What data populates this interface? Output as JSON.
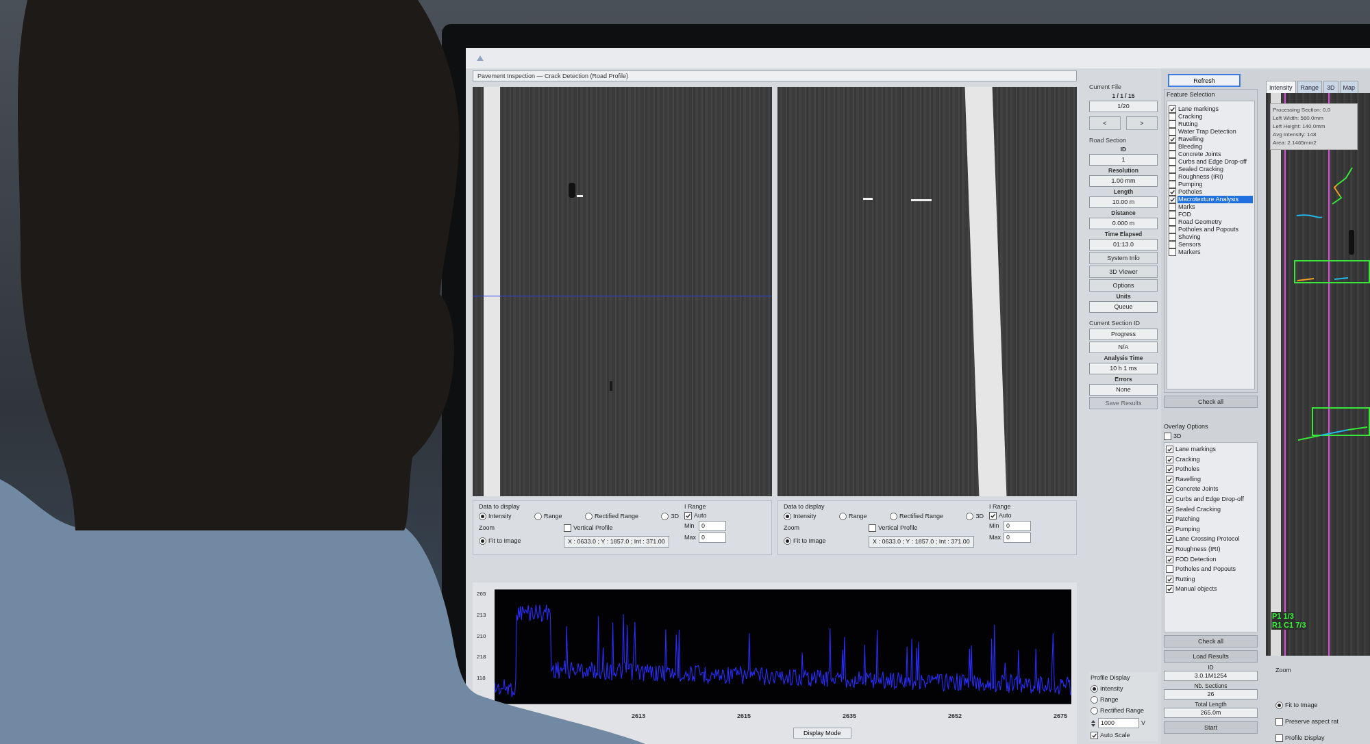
{
  "window": {
    "title": "Pavement Inspection — Crack Detection (Road Profile)"
  },
  "views": [
    {
      "data_label": "Data to display",
      "data_options": [
        {
          "label": "Intensity",
          "selected": true
        },
        {
          "label": "Range",
          "selected": false
        },
        {
          "label": "Rectified Range",
          "selected": false
        },
        {
          "label": "3D",
          "selected": false
        }
      ],
      "zoom_label": "Zoom",
      "zoom_option": {
        "label": "Fit to Image",
        "selected": true
      },
      "vertical_profile": {
        "label": "Vertical Profile",
        "checked": false
      },
      "readout": "X : 0633.0 ; Y : 1857.0 ; Int : 371.00",
      "range_label": "I Range",
      "auto": {
        "label": "Auto",
        "checked": true
      },
      "min": {
        "label": "Min",
        "value": "0"
      },
      "max": {
        "label": "Max",
        "value": "0"
      }
    },
    {
      "data_label": "Data to display",
      "data_options": [
        {
          "label": "Intensity",
          "selected": true
        },
        {
          "label": "Range",
          "selected": false
        },
        {
          "label": "Rectified Range",
          "selected": false
        },
        {
          "label": "3D",
          "selected": false
        }
      ],
      "zoom_label": "Zoom",
      "zoom_option": {
        "label": "Fit to Image",
        "selected": true
      },
      "vertical_profile": {
        "label": "Vertical Profile",
        "checked": false
      },
      "readout": "X : 0633.0 ; Y : 1857.0 ; Int : 371.00",
      "range_label": "I Range",
      "auto": {
        "label": "Auto",
        "checked": true
      },
      "min": {
        "label": "Min",
        "value": "0"
      },
      "max": {
        "label": "Max",
        "value": "0"
      }
    }
  ],
  "profile": {
    "y_labels": [
      "265",
      "213",
      "210",
      "218",
      "118"
    ],
    "x_labels": [
      "2613",
      "2615",
      "2635",
      "2652",
      "2675"
    ],
    "button": "Display Mode"
  },
  "nav": [
    {
      "kind": "label",
      "text": "Current File"
    },
    {
      "kind": "caption",
      "text": "1 / 1 / 15"
    },
    {
      "kind": "field",
      "text": "1/20"
    },
    {
      "kind": "pair",
      "items": [
        "<",
        ">"
      ]
    },
    {
      "kind": "label",
      "text": "Road Section"
    },
    {
      "kind": "caption",
      "text": "ID"
    },
    {
      "kind": "field",
      "text": "1"
    },
    {
      "kind": "caption",
      "text": "Resolution"
    },
    {
      "kind": "field",
      "text": "1.00 mm"
    },
    {
      "kind": "caption",
      "text": "Length"
    },
    {
      "kind": "field",
      "text": "10.00 m"
    },
    {
      "kind": "caption",
      "text": "Distance"
    },
    {
      "kind": "field",
      "text": "0.000 m"
    },
    {
      "kind": "caption",
      "text": "Time Elapsed"
    },
    {
      "kind": "field",
      "text": "01:13.0"
    },
    {
      "kind": "button",
      "text": "System Info",
      "disabled": false
    },
    {
      "kind": "button",
      "text": "3D Viewer",
      "disabled": false
    },
    {
      "kind": "button",
      "text": "Options",
      "disabled": false
    },
    {
      "kind": "caption",
      "text": "Units"
    },
    {
      "kind": "field",
      "text": "Queue"
    },
    {
      "kind": "label",
      "text": "Current Section ID"
    },
    {
      "kind": "field",
      "text": "Progress"
    },
    {
      "kind": "field",
      "text": "N/A"
    },
    {
      "kind": "caption",
      "text": "Analysis Time"
    },
    {
      "kind": "field",
      "text": "10 h 1 ms"
    },
    {
      "kind": "caption",
      "text": "Errors"
    },
    {
      "kind": "field",
      "text": "None"
    },
    {
      "kind": "button",
      "text": "Save Results",
      "disabled": true
    }
  ],
  "profile_display": {
    "title": "Profile Display",
    "options": [
      {
        "label": "Intensity",
        "selected": true
      },
      {
        "label": "Range",
        "selected": false
      },
      {
        "label": "Rectified Range",
        "selected": false
      }
    ],
    "spin_value": "1000",
    "unit": "V",
    "auto_scale": {
      "label": "Auto Scale",
      "checked": true
    }
  },
  "features": {
    "top_button": "Refresh",
    "title": "Feature Selection",
    "items": [
      {
        "label": "Lane markings",
        "checked": true,
        "selected": false
      },
      {
        "label": "Cracking",
        "checked": false,
        "selected": false
      },
      {
        "label": "Rutting",
        "checked": false,
        "selected": false
      },
      {
        "label": "Water Trap Detection",
        "checked": false,
        "selected": false
      },
      {
        "label": "Ravelling",
        "checked": true,
        "selected": false
      },
      {
        "label": "Bleeding",
        "checked": false,
        "selected": false
      },
      {
        "label": "Concrete Joints",
        "checked": false,
        "selected": false
      },
      {
        "label": "Curbs and Edge Drop-off",
        "checked": false,
        "selected": false
      },
      {
        "label": "Sealed Cracking",
        "checked": false,
        "selected": false
      },
      {
        "label": "Roughness (IRI)",
        "checked": false,
        "selected": false
      },
      {
        "label": "Pumping",
        "checked": false,
        "selected": false
      },
      {
        "label": "Potholes",
        "checked": true,
        "selected": false
      },
      {
        "label": "Macrotexture Analysis",
        "checked": true,
        "selected": true
      },
      {
        "label": "Marks",
        "checked": false,
        "selected": false
      },
      {
        "label": "FOD",
        "checked": false,
        "selected": false
      },
      {
        "label": "Road Geometry",
        "checked": false,
        "selected": false
      },
      {
        "label": "Potholes and Popouts",
        "checked": false,
        "selected": false
      },
      {
        "label": "Shoving",
        "checked": false,
        "selected": false
      },
      {
        "label": "Sensors",
        "checked": false,
        "selected": false
      },
      {
        "label": "Markers",
        "checked": false,
        "selected": false
      }
    ],
    "check_all": "Check all"
  },
  "overlay": {
    "title": "Overlay Options",
    "three_d": {
      "label": "3D",
      "checked": false
    },
    "items": [
      {
        "label": "Lane markings",
        "checked": true
      },
      {
        "label": "Cracking",
        "checked": true
      },
      {
        "label": "Potholes",
        "checked": true
      },
      {
        "label": "Ravelling",
        "checked": true
      },
      {
        "label": "Concrete Joints",
        "checked": true
      },
      {
        "label": "Curbs and Edge Drop-off",
        "checked": true
      },
      {
        "label": "Sealed Cracking",
        "checked": true
      },
      {
        "label": "Patching",
        "checked": true
      },
      {
        "label": "Pumping",
        "checked": true
      },
      {
        "label": "Lane Crossing Protocol",
        "checked": true
      },
      {
        "label": "Roughness (IRI)",
        "checked": true
      },
      {
        "label": "FOD Detection",
        "checked": true
      },
      {
        "label": "Potholes and Popouts",
        "checked": false
      },
      {
        "label": "Rutting",
        "checked": true
      },
      {
        "label": "Manual objects",
        "checked": true
      }
    ],
    "check_all": "Check all",
    "load": "Load Results",
    "fields": [
      {
        "caption": "ID",
        "value": "3.0.1M1254"
      },
      {
        "caption": "Nb. Sections",
        "value": "26"
      },
      {
        "caption": "Total Length",
        "value": "265.0m"
      }
    ],
    "start": "Start"
  },
  "viewer": {
    "tabs": [
      {
        "label": "Intensity",
        "selected": true
      },
      {
        "label": "Range",
        "selected": false
      },
      {
        "label": "3D",
        "selected": false
      },
      {
        "label": "Map",
        "selected": false
      }
    ],
    "info_lines": [
      "Processing Section: 0.0",
      "Left Width: 560.0mm",
      "Left Height: 140.0mm",
      "Avg Intensity: 148",
      "Area: 2.1465mm2"
    ],
    "marker_labels": [
      "P1 1/3",
      "R1 C1 7/3"
    ],
    "zoom_label": "Zoom",
    "zoom_option": {
      "label": "Fit to Image",
      "selected": true
    },
    "aspect": {
      "label": "Preserve aspect rat",
      "checked": false
    },
    "profile_display": {
      "label": "Profile Display",
      "checked": false
    }
  }
}
